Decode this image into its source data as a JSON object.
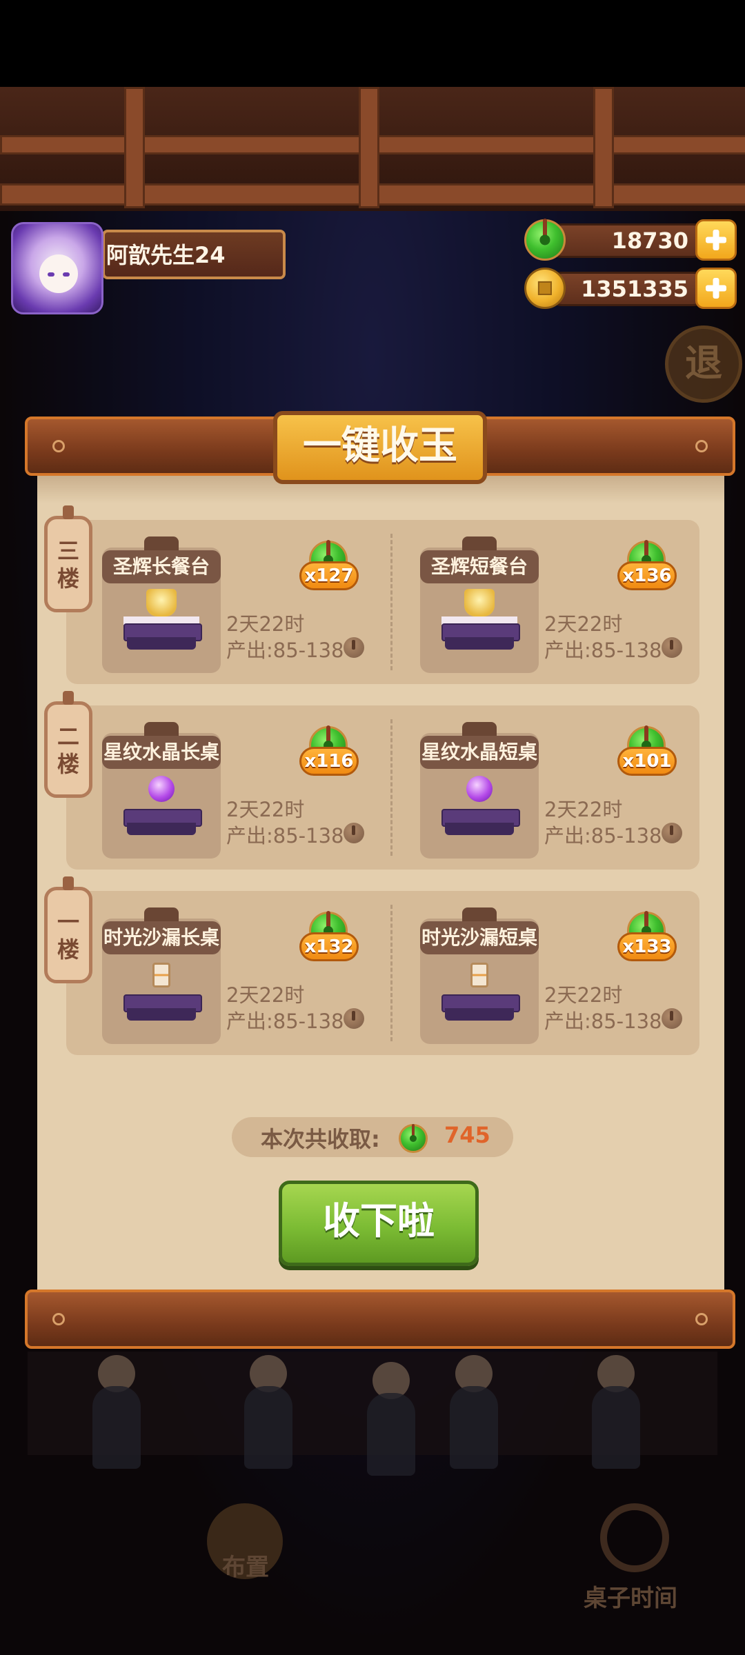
{
  "profile": {
    "name": "阿歆先生24"
  },
  "currency": {
    "jade": {
      "value": "18730",
      "icon": "jade-icon"
    },
    "gold": {
      "value": "1351335",
      "icon": "gold-coin-icon"
    }
  },
  "exit_label": "退",
  "modal": {
    "title": "一键收玉",
    "floors": [
      {
        "label": "三楼",
        "items": [
          {
            "name": "圣辉长餐台",
            "count": "x127",
            "time": "2天22时",
            "production": "产出:85-138",
            "deco": "gold"
          },
          {
            "name": "圣辉短餐台",
            "count": "x136",
            "time": "2天22时",
            "production": "产出:85-138",
            "deco": "gold"
          }
        ]
      },
      {
        "label": "二楼",
        "items": [
          {
            "name": "星纹水晶长桌",
            "count": "x116",
            "time": "2天22时",
            "production": "产出:85-138",
            "deco": "crystal"
          },
          {
            "name": "星纹水晶短桌",
            "count": "x101",
            "time": "2天22时",
            "production": "产出:85-138",
            "deco": "crystal"
          }
        ]
      },
      {
        "label": "一楼",
        "items": [
          {
            "name": "时光沙漏长桌",
            "count": "x132",
            "time": "2天22时",
            "production": "产出:85-138",
            "deco": "hourglass"
          },
          {
            "name": "时光沙漏短桌",
            "count": "x133",
            "time": "2天22时",
            "production": "产出:85-138",
            "deco": "hourglass"
          }
        ]
      }
    ],
    "summary_label": "本次共收取:",
    "summary_value": "745",
    "collect_button": "收下啦"
  },
  "bottom_nav": {
    "layout": "布置",
    "table_time": "桌子时间"
  },
  "colors": {
    "accent_orange": "#e0931c",
    "jade_green": "#3fbf2e",
    "paper": "#e4cfae",
    "button_green": "#7cbc34"
  }
}
